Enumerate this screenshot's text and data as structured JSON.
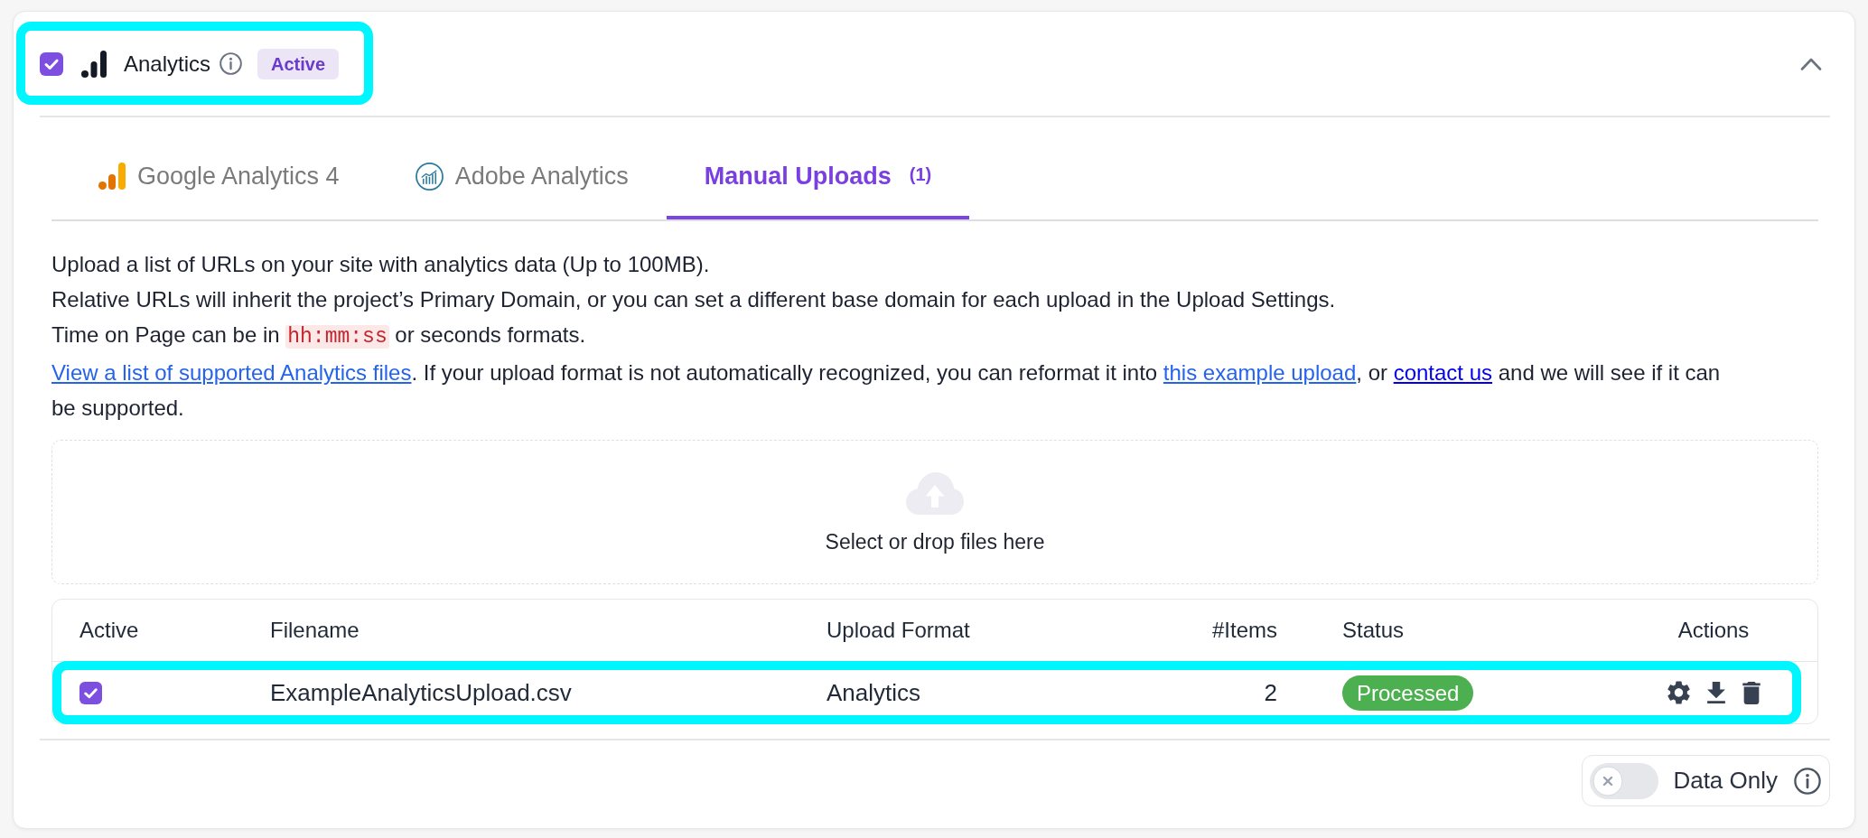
{
  "section": {
    "title": "Analytics",
    "checked": true,
    "badge": "Active",
    "expanded": true,
    "highlighted": true
  },
  "tabs": [
    {
      "label": "Google Analytics 4",
      "kind": "google",
      "selected": false
    },
    {
      "label": "Adobe Analytics",
      "kind": "adobe",
      "selected": false
    },
    {
      "label": "Manual Uploads",
      "count": "(1)",
      "kind": "manual",
      "selected": true
    }
  ],
  "description": {
    "paragraphs": [
      {
        "segments": [
          {
            "kind": "text",
            "text": "Upload a list of URLs on your site with analytics data (Up to 100MB)."
          }
        ]
      },
      {
        "segments": [
          {
            "kind": "text",
            "text": "Relative URLs will inherit the project’s Primary Domain, or you can set a different base domain for each upload in the Upload Settings."
          }
        ]
      },
      {
        "segments": [
          {
            "kind": "text",
            "text": "Time on Page can be in "
          },
          {
            "kind": "code",
            "text": "hh:mm:ss"
          },
          {
            "kind": "text",
            "text": " or seconds formats."
          }
        ]
      },
      {
        "segments": [
          {
            "kind": "link",
            "text": "View a list of supported Analytics files",
            "color": "#2563eb"
          },
          {
            "kind": "text",
            "text": ". If your upload format is not automatically recognized, you can reformat it into "
          },
          {
            "kind": "link",
            "text": "this example upload",
            "color": "#2563eb"
          },
          {
            "kind": "text",
            "text": ", or "
          },
          {
            "kind": "link",
            "text": "contact us",
            "color": "#0000ee"
          },
          {
            "kind": "text",
            "text": " and we will see if it can be supported."
          }
        ]
      }
    ]
  },
  "drop_zone": {
    "label": "Select or drop files here"
  },
  "uploads_table": {
    "columns": [
      "Active",
      "Filename",
      "Upload Format",
      "#Items",
      "Status",
      "Actions"
    ],
    "rows": [
      {
        "active": true,
        "filename": "ExampleAnalyticsUpload.csv",
        "upload_format": "Analytics",
        "items": "2",
        "status": "Processed",
        "highlighted": true
      }
    ]
  },
  "footer": {
    "toggle": {
      "label": "Data Only",
      "on": false
    }
  }
}
